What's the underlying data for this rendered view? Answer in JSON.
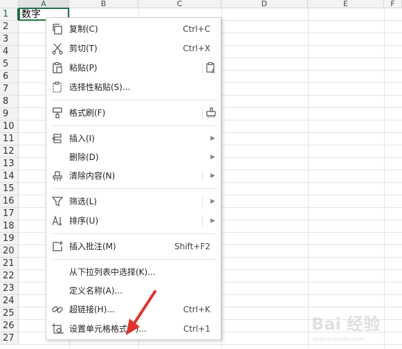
{
  "sheet": {
    "columns": [
      "A",
      "B",
      "C",
      "D",
      "E",
      "F"
    ],
    "rows": [
      "1",
      "2",
      "3",
      "4",
      "5",
      "6",
      "7",
      "8",
      "9",
      "10",
      "11",
      "12",
      "13",
      "14",
      "15",
      "16",
      "17",
      "18",
      "19",
      "20",
      "21",
      "22",
      "23",
      "24",
      "25",
      "26",
      "27"
    ],
    "cell_a1": "数字",
    "accent_color": "#1e7145"
  },
  "context_menu": {
    "items": [
      {
        "label": "复制(C)",
        "shortcut": "Ctrl+C",
        "icon": "copy-icon"
      },
      {
        "label": "剪切(T)",
        "shortcut": "Ctrl+X",
        "icon": "scissors-icon"
      },
      {
        "label": "粘贴(P)",
        "shortcut": "",
        "icon": "paste-icon"
      },
      {
        "label": "选择性粘贴(S)...",
        "shortcut": "",
        "icon": "paste-special-icon"
      },
      {
        "label": "格式刷(F)",
        "shortcut": "",
        "icon": "format-brush-icon"
      },
      {
        "label": "插入(I)",
        "shortcut": "",
        "icon": "insert-icon"
      },
      {
        "label": "删除(D)",
        "shortcut": "",
        "icon": ""
      },
      {
        "label": "清除内容(N)",
        "shortcut": "",
        "icon": "eraser-icon"
      },
      {
        "label": "筛选(L)",
        "shortcut": "",
        "icon": "filter-icon"
      },
      {
        "label": "排序(U)",
        "shortcut": "",
        "icon": "sort-icon"
      },
      {
        "label": "插入批注(M)",
        "shortcut": "Shift+F2",
        "icon": "comment-icon"
      },
      {
        "label": "从下拉列表中选择(K)...",
        "shortcut": "",
        "icon": ""
      },
      {
        "label": "定义名称(A)...",
        "shortcut": "",
        "icon": ""
      },
      {
        "label": "超链接(H)...",
        "shortcut": "Ctrl+K",
        "icon": "link-icon"
      },
      {
        "label": "设置单元格格式(F)...",
        "shortcut": "Ctrl+1",
        "icon": "cell-format-icon"
      }
    ]
  },
  "annotation": {
    "arrow_color": "#e0322a"
  },
  "watermark": {
    "text": "Bai 经验"
  }
}
